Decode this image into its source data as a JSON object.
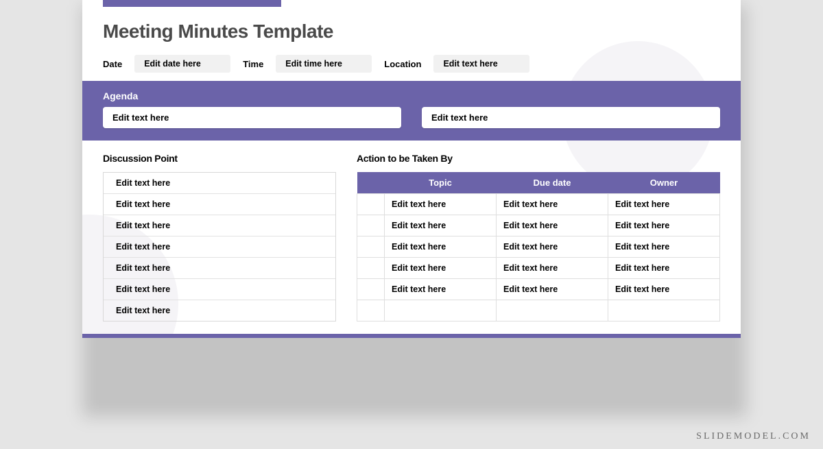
{
  "title": "Meeting Minutes Template",
  "meta": {
    "date_label": "Date",
    "date_value": "Edit date here",
    "time_label": "Time",
    "time_value": "Edit time here",
    "location_label": "Location",
    "location_value": "Edit text here"
  },
  "agenda": {
    "heading": "Agenda",
    "items": [
      "Edit text here",
      "Edit text here"
    ]
  },
  "discussion": {
    "heading": "Discussion Point",
    "rows": [
      "Edit text here",
      "Edit text here",
      "Edit text here",
      "Edit text here",
      "Edit text here",
      "Edit text here",
      "Edit text here"
    ]
  },
  "actions": {
    "heading": "Action to be Taken By",
    "columns": [
      "Topic",
      "Due date",
      "Owner"
    ],
    "rows": [
      {
        "topic": "Edit text here",
        "due": "Edit text here",
        "owner": "Edit text here"
      },
      {
        "topic": "Edit text here",
        "due": "Edit text here",
        "owner": "Edit text here"
      },
      {
        "topic": "Edit text here",
        "due": "Edit text here",
        "owner": "Edit text here"
      },
      {
        "topic": "Edit text here",
        "due": "Edit text here",
        "owner": "Edit text here"
      },
      {
        "topic": "Edit text here",
        "due": "Edit text here",
        "owner": "Edit text here"
      },
      {
        "topic": "",
        "due": "",
        "owner": ""
      }
    ]
  },
  "watermark": "SLIDEMODEL.COM"
}
